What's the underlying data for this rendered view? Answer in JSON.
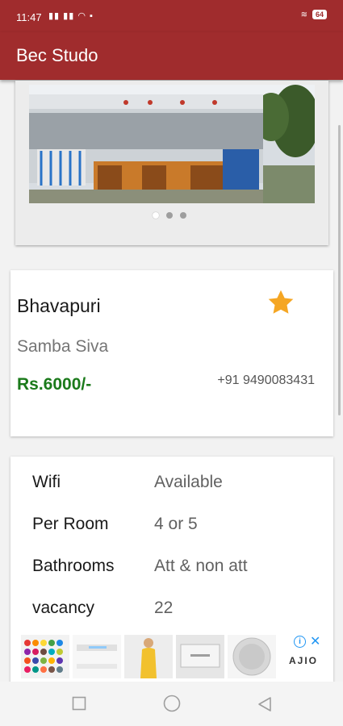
{
  "status_bar": {
    "time": "11:47",
    "battery": "64"
  },
  "app": {
    "title": "Bec Studo"
  },
  "listing": {
    "name": "Bhavapuri",
    "owner": "Samba Siva",
    "price": "Rs.6000/-",
    "phone": "+91 9490083431"
  },
  "details": [
    {
      "label": "Wifi",
      "value": "Available"
    },
    {
      "label": "Per Room",
      "value": "4 or 5"
    },
    {
      "label": "Bathrooms",
      "value": "Att & non att"
    },
    {
      "label": "vacancy",
      "value": "22"
    }
  ],
  "ad": {
    "brand": "AJIO"
  },
  "colors": {
    "primary": "#a02c2d",
    "price_green": "#1b7a1b",
    "star": "#f5a623"
  },
  "icons": [
    "star-icon",
    "square-icon",
    "circle-icon",
    "back-triangle-icon",
    "wifi-icon",
    "signal-icon",
    "battery-icon",
    "ad-info-icon",
    "close-icon"
  ]
}
